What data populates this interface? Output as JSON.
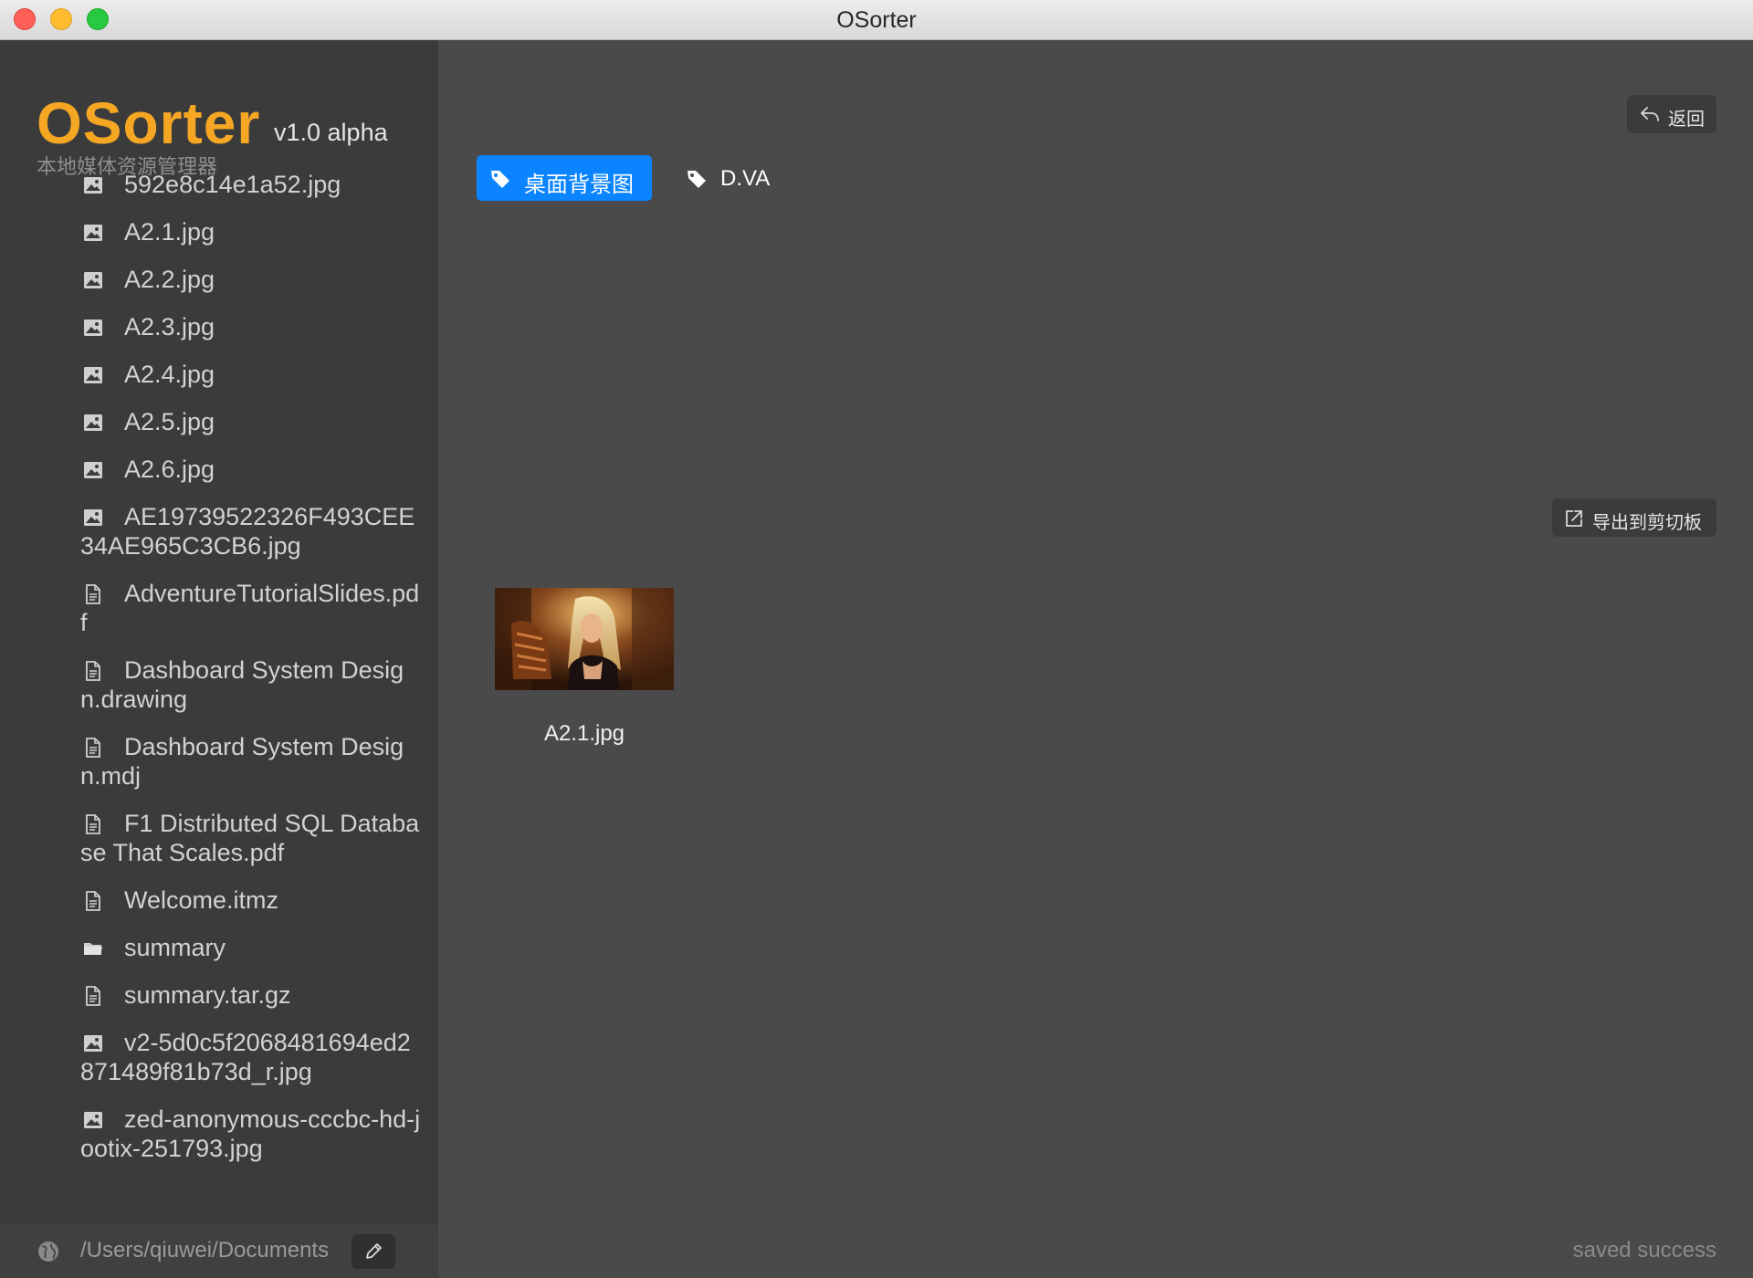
{
  "window": {
    "title": "OSorter"
  },
  "sidebar": {
    "logo": "OSorter",
    "version": "v1.0 alpha",
    "subtitle": "本地媒体资源管理器",
    "files": [
      {
        "name": "592e8c14e1a52.jpg",
        "icon": "image-icon"
      },
      {
        "name": "A2.1.jpg",
        "icon": "image-icon"
      },
      {
        "name": "A2.2.jpg",
        "icon": "image-icon"
      },
      {
        "name": "A2.3.jpg",
        "icon": "image-icon"
      },
      {
        "name": "A2.4.jpg",
        "icon": "image-icon"
      },
      {
        "name": "A2.5.jpg",
        "icon": "image-icon"
      },
      {
        "name": "A2.6.jpg",
        "icon": "image-icon"
      },
      {
        "name": "AE19739522326F493CEE34AE965C3CB6.jpg",
        "icon": "image-icon"
      },
      {
        "name": "AdventureTutorialSlides.pdf",
        "icon": "document-icon"
      },
      {
        "name": "Dashboard System Design.drawing",
        "icon": "document-icon"
      },
      {
        "name": "Dashboard System Design.mdj",
        "icon": "document-icon"
      },
      {
        "name": "F1 Distributed SQL Database That Scales.pdf",
        "icon": "document-icon"
      },
      {
        "name": "Welcome.itmz",
        "icon": "document-icon"
      },
      {
        "name": "summary",
        "icon": "folder-icon"
      },
      {
        "name": "summary.tar.gz",
        "icon": "document-icon"
      },
      {
        "name": "v2-5d0c5f2068481694ed2871489f81b73d_r.jpg",
        "icon": "image-icon"
      },
      {
        "name": "zed-anonymous-cccbc-hd-jootix-251793.jpg",
        "icon": "image-icon"
      }
    ]
  },
  "main": {
    "back_label": "返回",
    "tags": [
      {
        "label": "桌面背景图",
        "active": true
      },
      {
        "label": "D.VA",
        "active": false
      }
    ],
    "export_label": "导出到剪切板",
    "results": [
      {
        "name": "A2.1.jpg"
      }
    ]
  },
  "status": {
    "path": "/Users/qiuwei/Documents",
    "message": "saved success"
  },
  "colors": {
    "accent": "#f5a623",
    "tag_active": "#0a84ff",
    "sidebar_bg": "#3b3b3b",
    "main_bg": "#4a4a4a"
  }
}
